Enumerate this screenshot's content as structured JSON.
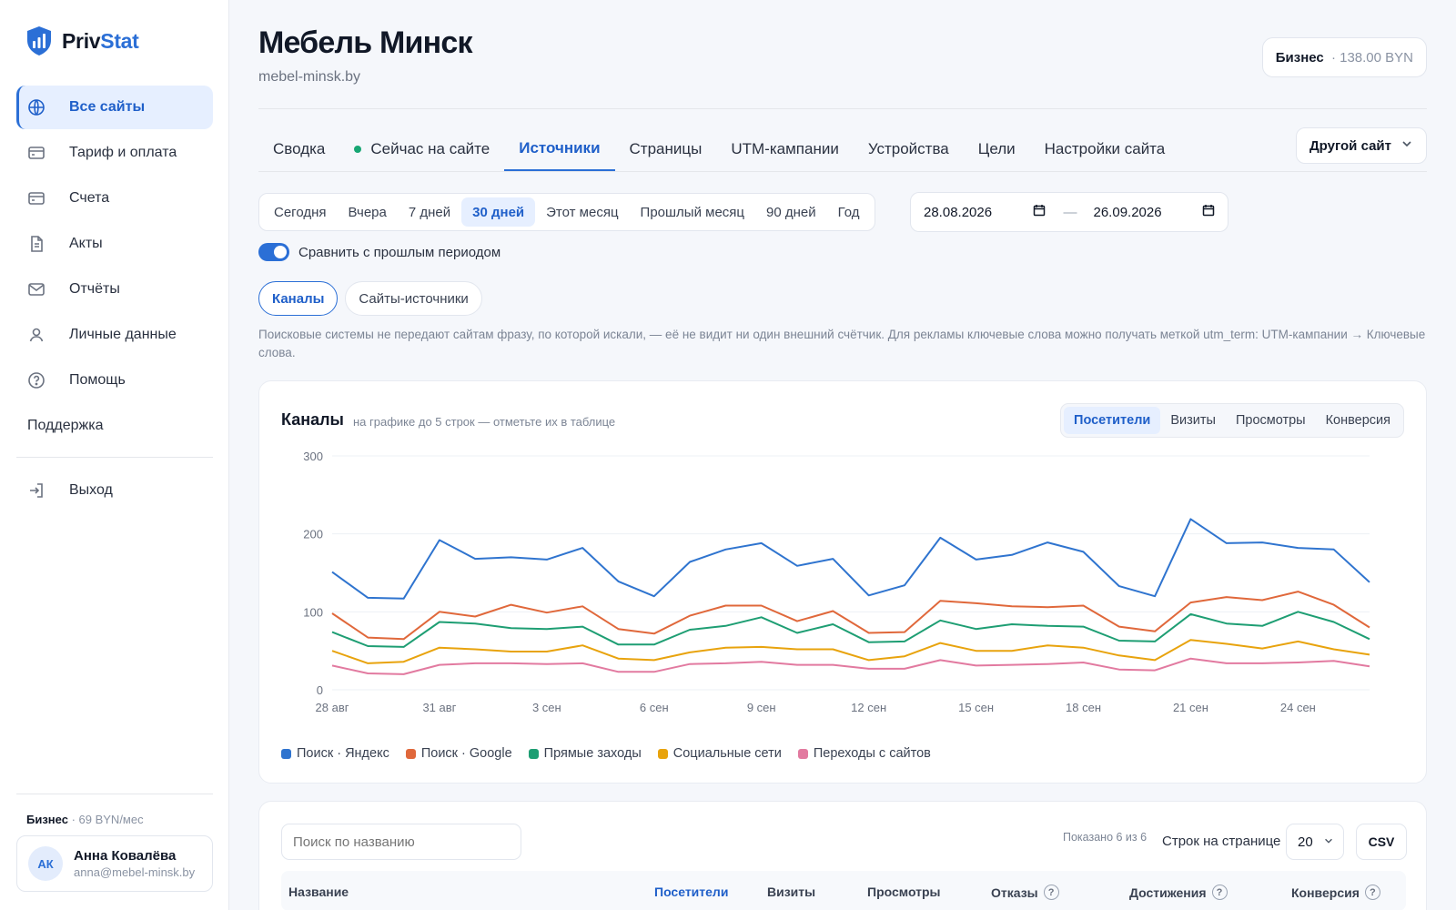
{
  "app": {
    "logo_main": "Priv",
    "logo_accent": "Stat"
  },
  "sidebar": {
    "items": [
      {
        "label": "Все сайты",
        "icon": "globe-icon",
        "active": true
      },
      {
        "label": "Тариф и оплата",
        "icon": "card-icon"
      },
      {
        "label": "Счета",
        "icon": "card-icon"
      },
      {
        "label": "Акты",
        "icon": "document-icon"
      },
      {
        "label": "Отчёты",
        "icon": "mail-icon"
      },
      {
        "label": "Личные данные",
        "icon": "user-icon"
      },
      {
        "label": "Помощь",
        "icon": "help-icon"
      }
    ],
    "support": "Поддержка",
    "logout": "Выход",
    "plan_name": "Бизнес",
    "plan_price": "· 69 BYN/мес",
    "user": {
      "initials": "АК",
      "name": "Анна Ковалёва",
      "email": "anna@mebel-minsk.by"
    }
  },
  "header": {
    "title": "Мебель Минск",
    "domain": "mebel-minsk.by",
    "plan_name": "Бизнес",
    "plan_balance": "· 138.00 BYN"
  },
  "tabs": [
    {
      "label": "Сводка"
    },
    {
      "label": "Сейчас на сайте",
      "live": true
    },
    {
      "label": "Источники",
      "active": true
    },
    {
      "label": "Страницы"
    },
    {
      "label": "UTM-кампании"
    },
    {
      "label": "Устройства"
    },
    {
      "label": "Цели"
    },
    {
      "label": "Настройки сайта"
    }
  ],
  "other_site": "Другой сайт",
  "periods": [
    "Сегодня",
    "Вчера",
    "7 дней",
    "30 дней",
    "Этот месяц",
    "Прошлый месяц",
    "90 дней",
    "Год"
  ],
  "active_period": "30 дней",
  "date_from": "28.08.2026",
  "date_to": "26.09.2026",
  "date_sep": "—",
  "compare_label": "Сравнить с прошлым периодом",
  "subtabs": [
    "Каналы",
    "Сайты-источники"
  ],
  "note": "Поисковые системы не передают сайтам фразу, по которой искали, — её не видит ни один внешний счётчик. Для рекламы ключевые слова можно получать меткой utm_term: UTM-кампании → Ключевые слова.",
  "chart_card": {
    "title": "Каналы",
    "subtitle": "на графике до 5 строк — отметьте их в таблице",
    "metrics": [
      "Посетители",
      "Визиты",
      "Просмотры",
      "Конверсия"
    ],
    "active_metric": "Посетители"
  },
  "chart_data": {
    "type": "line",
    "x_start": "28 авг",
    "x_tick_labels": [
      "28 авг",
      "31 авг",
      "3 сен",
      "6 сен",
      "9 сен",
      "12 сен",
      "15 сен",
      "18 сен",
      "21 сен",
      "24 сен"
    ],
    "y_ticks": [
      0,
      100,
      200,
      300
    ],
    "ylim": [
      0,
      300
    ],
    "grid": true,
    "legend_position": "bottom-left",
    "series": [
      {
        "name": "Поиск · Яндекс",
        "color": "#2f74cf",
        "values": [
          151,
          118,
          117,
          192,
          168,
          170,
          167,
          182,
          139,
          120,
          164,
          180,
          188,
          159,
          168,
          121,
          134,
          195,
          167,
          173,
          189,
          177,
          133,
          120,
          219,
          188,
          189,
          182,
          180,
          138
        ]
      },
      {
        "name": "Поиск · Google",
        "color": "#e0683b",
        "values": [
          98,
          67,
          65,
          100,
          94,
          109,
          99,
          107,
          78,
          72,
          95,
          108,
          108,
          88,
          101,
          73,
          74,
          114,
          111,
          107,
          106,
          108,
          81,
          75,
          112,
          119,
          115,
          126,
          109,
          80
        ]
      },
      {
        "name": "Прямые заходы",
        "color": "#1e9e73",
        "values": [
          74,
          56,
          55,
          87,
          85,
          79,
          78,
          81,
          58,
          58,
          77,
          82,
          93,
          73,
          84,
          61,
          62,
          89,
          78,
          84,
          82,
          81,
          63,
          62,
          97,
          85,
          82,
          100,
          87,
          65
        ]
      },
      {
        "name": "Социальные сети",
        "color": "#e8a30d",
        "values": [
          50,
          34,
          36,
          54,
          52,
          49,
          49,
          57,
          40,
          38,
          48,
          54,
          55,
          52,
          52,
          38,
          43,
          60,
          50,
          50,
          57,
          54,
          44,
          38,
          64,
          59,
          53,
          62,
          52,
          45
        ]
      },
      {
        "name": "Переходы с сайтов",
        "color": "#e27aa0",
        "values": [
          31,
          21,
          20,
          32,
          34,
          34,
          33,
          34,
          23,
          23,
          33,
          34,
          36,
          32,
          32,
          27,
          27,
          38,
          31,
          32,
          33,
          35,
          26,
          25,
          40,
          34,
          34,
          35,
          37,
          30
        ]
      }
    ]
  },
  "table": {
    "search_placeholder": "Поиск по названию",
    "shown": "Показано 6 из 6",
    "rows_label": "Строк на странице",
    "rows_value": "20",
    "csv_label": "CSV",
    "columns": [
      "Название",
      "Посетители",
      "Визиты",
      "Просмотры",
      "Отказы",
      "Достижения",
      "Конверсия"
    ],
    "active_column": "Посетители"
  }
}
